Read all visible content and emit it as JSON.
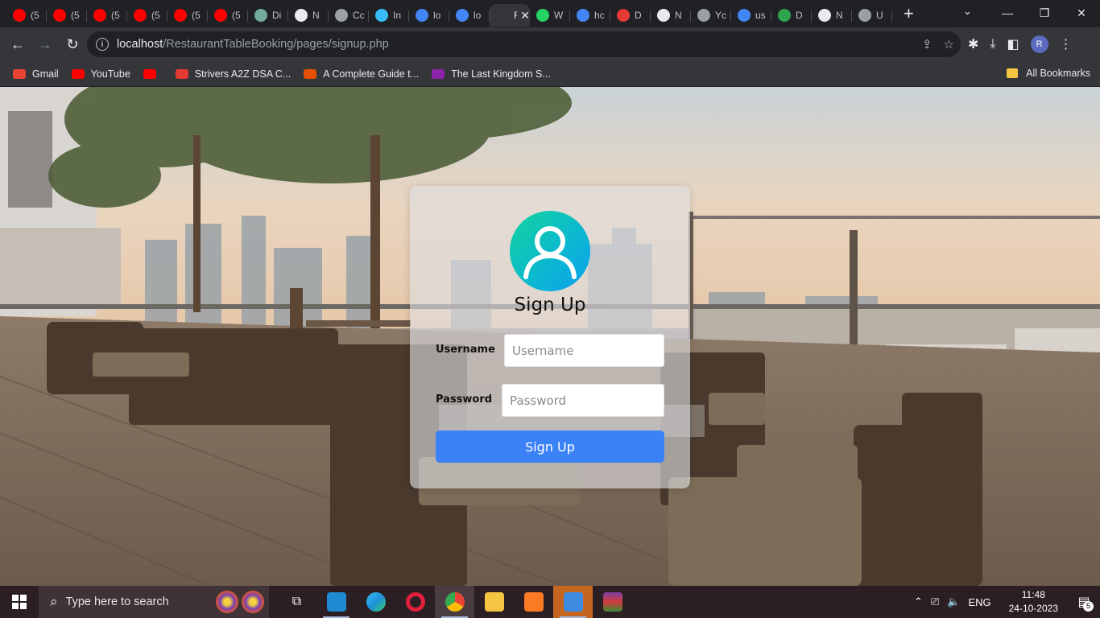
{
  "browser": {
    "tabs": [
      {
        "title": "(5",
        "favicon": "youtube-icon",
        "color": "#ff0000"
      },
      {
        "title": "(5",
        "favicon": "youtube-icon",
        "color": "#ff0000"
      },
      {
        "title": "(5",
        "favicon": "youtube-icon",
        "color": "#ff0000"
      },
      {
        "title": "(5",
        "favicon": "youtube-icon",
        "color": "#ff0000"
      },
      {
        "title": "(5",
        "favicon": "youtube-icon",
        "color": "#ff0000"
      },
      {
        "title": "(5",
        "favicon": "youtube-icon",
        "color": "#ff0000"
      },
      {
        "title": "Di",
        "favicon": "chatgpt-icon",
        "color": "#74aa9c"
      },
      {
        "title": "N",
        "favicon": "github-icon",
        "color": "#e8eaed"
      },
      {
        "title": "Cc",
        "favicon": "globe-icon",
        "color": "#9aa0a6"
      },
      {
        "title": "In",
        "favicon": "tailwind-icon",
        "color": "#38bdf8"
      },
      {
        "title": "lo",
        "favicon": "google-icon",
        "color": "#4285f4"
      },
      {
        "title": "lo",
        "favicon": "google-icon",
        "color": "#4285f4"
      },
      {
        "title": "Re",
        "favicon": "page-icon",
        "color": "#35363a",
        "active": true
      },
      {
        "title": "W",
        "favicon": "whatsapp-icon",
        "color": "#25d366"
      },
      {
        "title": "hc",
        "favicon": "google-icon",
        "color": "#4285f4"
      },
      {
        "title": "D",
        "favicon": "number-two-icon",
        "color": "#e53935"
      },
      {
        "title": "N",
        "favicon": "github-icon",
        "color": "#e8eaed"
      },
      {
        "title": "Yc",
        "favicon": "globe-icon",
        "color": "#9aa0a6"
      },
      {
        "title": "us",
        "favicon": "google-icon",
        "color": "#4285f4"
      },
      {
        "title": "D",
        "favicon": "dsa-icon",
        "color": "#2ea44f"
      },
      {
        "title": "N",
        "favicon": "github-icon",
        "color": "#e8eaed"
      },
      {
        "title": "U",
        "favicon": "globe-icon",
        "color": "#9aa0a6"
      }
    ],
    "new_tab": "+",
    "url_host": "localhost",
    "url_path": "/RestaurantTableBooking/pages/signup.php",
    "profile_initial": "R",
    "bookmarks": [
      {
        "label": "Gmail",
        "icon": "gmail-icon",
        "color": "#ea4335"
      },
      {
        "label": "YouTube",
        "icon": "youtube-icon",
        "color": "#ff0000"
      },
      {
        "label": "",
        "icon": "youtube-icon",
        "color": "#ff0000"
      },
      {
        "label": "Strivers A2Z DSA C...",
        "icon": "tuf-icon",
        "color": "#e53935"
      },
      {
        "label": "A Complete Guide t...",
        "icon": "asterisk-icon",
        "color": "#e65100"
      },
      {
        "label": "The Last Kingdom S...",
        "icon": "movie-icon",
        "color": "#8e24aa"
      }
    ],
    "all_bookmarks": "All Bookmarks"
  },
  "signup": {
    "title": "Sign Up",
    "username_label": "Username",
    "username_placeholder": "Username",
    "password_label": "Password",
    "password_placeholder": "Password",
    "submit_label": "Sign Up"
  },
  "taskbar": {
    "search_placeholder": "Type here to search",
    "language": "ENG",
    "time": "11:48",
    "date": "24-10-2023",
    "notification_count": "5"
  }
}
